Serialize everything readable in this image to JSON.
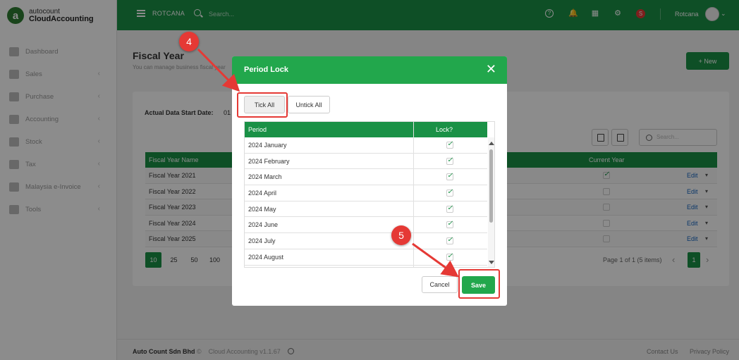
{
  "brand": {
    "line1": "autocount",
    "line2": "CloudAccounting",
    "mark": "a"
  },
  "sidebar": {
    "items": [
      {
        "label": "Dashboard",
        "icon": "dashboard-icon",
        "has_children": false
      },
      {
        "label": "Sales",
        "icon": "sales-icon",
        "has_children": true
      },
      {
        "label": "Purchase",
        "icon": "purchase-icon",
        "has_children": true
      },
      {
        "label": "Accounting",
        "icon": "accounting-icon",
        "has_children": true
      },
      {
        "label": "Stock",
        "icon": "stock-icon",
        "has_children": true
      },
      {
        "label": "Tax",
        "icon": "tax-icon",
        "has_children": true
      },
      {
        "label": "Malaysia e-Invoice",
        "icon": "einvoice-icon",
        "has_children": true
      },
      {
        "label": "Tools",
        "icon": "wrench-icon",
        "has_children": true
      }
    ]
  },
  "topbar": {
    "company": "ROTCANA",
    "search_placeholder": "Search...",
    "user": "Rotcana",
    "badge": "S"
  },
  "page": {
    "title": "Fiscal Year",
    "subtitle": "You can manage business fiscal year",
    "new_button": "+ New"
  },
  "filters": {
    "start_date_label": "Actual Data Start Date:",
    "start_date_value": "01",
    "search_placeholder": "Search..."
  },
  "fy_table": {
    "col_name": "Fiscal Year Name",
    "col_current": "Current Year",
    "rows": [
      {
        "name": "Fiscal Year 2021",
        "current": true,
        "edit": "Edit"
      },
      {
        "name": "Fiscal Year 2022",
        "current": false,
        "edit": "Edit"
      },
      {
        "name": "Fiscal Year 2023",
        "current": false,
        "edit": "Edit"
      },
      {
        "name": "Fiscal Year 2024",
        "current": false,
        "edit": "Edit"
      },
      {
        "name": "Fiscal Year 2025",
        "current": false,
        "edit": "Edit"
      }
    ]
  },
  "pager": {
    "sizes": [
      "10",
      "25",
      "50",
      "100"
    ],
    "info": "Page 1 of 1 (5 items)",
    "current": "1"
  },
  "footer": {
    "company": "Auto Count Sdn Bhd",
    "copyright": "©",
    "version": "Cloud Accounting v1.1.67",
    "contact": "Contact Us",
    "privacy": "Privacy Policy"
  },
  "modal": {
    "title": "Period Lock",
    "close": "✕",
    "tick_all": "Tick All",
    "untick_all": "Untick All",
    "col_period": "Period",
    "col_lock": "Lock?",
    "rows": [
      {
        "period": "2024 January",
        "locked": true
      },
      {
        "period": "2024 February",
        "locked": true
      },
      {
        "period": "2024 March",
        "locked": true
      },
      {
        "period": "2024 April",
        "locked": true
      },
      {
        "period": "2024 May",
        "locked": true
      },
      {
        "period": "2024 June",
        "locked": true
      },
      {
        "period": "2024 July",
        "locked": true
      },
      {
        "period": "2024 August",
        "locked": true
      }
    ],
    "cancel": "Cancel",
    "save": "Save"
  },
  "annotations": {
    "step4": "4",
    "step5": "5"
  },
  "colors": {
    "primary": "#1a9146",
    "modal_header": "#22a74c",
    "annotation": "#e53935"
  }
}
